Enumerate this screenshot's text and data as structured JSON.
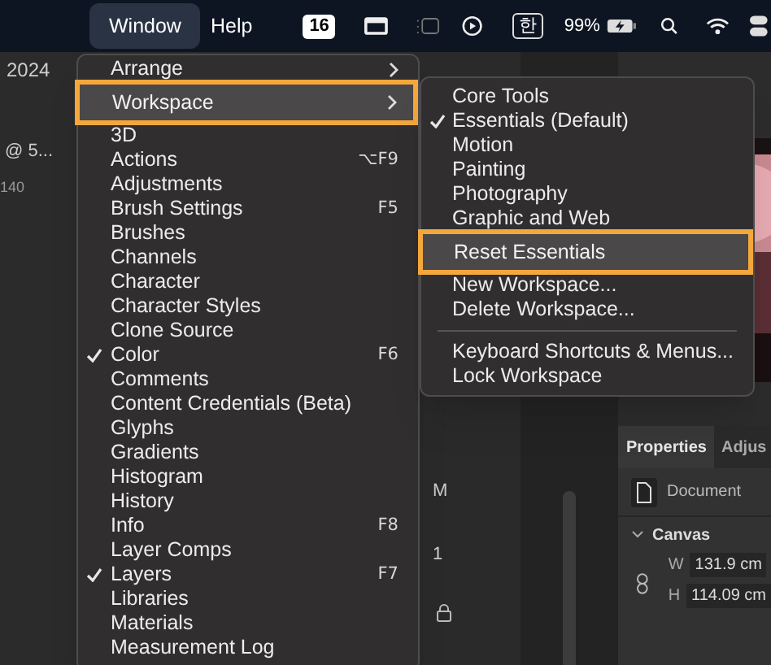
{
  "menu_bar": {
    "items": [
      {
        "label": "Window",
        "selected": true
      },
      {
        "label": "Help",
        "selected": false
      }
    ],
    "badge": "16",
    "input_source": "한",
    "battery": "99%"
  },
  "app": {
    "title_fragment": "2024",
    "doc_tab": "@ 5...",
    "ruler": "140",
    "layer_rows": [
      "M",
      "1"
    ],
    "properties": {
      "tabs": [
        {
          "label": "Properties",
          "selected": true
        },
        {
          "label": "Adjus",
          "selected": false
        }
      ],
      "document": "Document",
      "section": "Canvas",
      "fields": [
        {
          "label": "W",
          "value": "131.9 cm"
        },
        {
          "label": "H",
          "value": "114.09 cm"
        }
      ]
    }
  },
  "window_menu": {
    "items": [
      {
        "kind": "submenu",
        "label": "Arrange",
        "checked": false,
        "highlighted": false
      },
      {
        "kind": "submenu",
        "label": "Workspace",
        "checked": false,
        "highlighted": true
      },
      {
        "kind": "item",
        "label": "3D",
        "checked": false,
        "highlighted": false
      },
      {
        "kind": "item",
        "label": "Actions",
        "shortcut": "⌥F9",
        "checked": false,
        "highlighted": false
      },
      {
        "kind": "item",
        "label": "Adjustments",
        "checked": false,
        "highlighted": false
      },
      {
        "kind": "item",
        "label": "Brush Settings",
        "shortcut": "F5",
        "checked": false,
        "highlighted": false
      },
      {
        "kind": "item",
        "label": "Brushes",
        "checked": false,
        "highlighted": false
      },
      {
        "kind": "item",
        "label": "Channels",
        "checked": false,
        "highlighted": false
      },
      {
        "kind": "item",
        "label": "Character",
        "checked": false,
        "highlighted": false
      },
      {
        "kind": "item",
        "label": "Character Styles",
        "checked": false,
        "highlighted": false
      },
      {
        "kind": "item",
        "label": "Clone Source",
        "checked": false,
        "highlighted": false
      },
      {
        "kind": "item",
        "label": "Color",
        "shortcut": "F6",
        "checked": true,
        "highlighted": false
      },
      {
        "kind": "item",
        "label": "Comments",
        "checked": false,
        "highlighted": false
      },
      {
        "kind": "item",
        "label": "Content Credentials (Beta)",
        "checked": false,
        "highlighted": false
      },
      {
        "kind": "item",
        "label": "Glyphs",
        "checked": false,
        "highlighted": false
      },
      {
        "kind": "item",
        "label": "Gradients",
        "checked": false,
        "highlighted": false
      },
      {
        "kind": "item",
        "label": "Histogram",
        "checked": false,
        "highlighted": false
      },
      {
        "kind": "item",
        "label": "History",
        "checked": false,
        "highlighted": false
      },
      {
        "kind": "item",
        "label": "Info",
        "shortcut": "F8",
        "checked": false,
        "highlighted": false
      },
      {
        "kind": "item",
        "label": "Layer Comps",
        "checked": false,
        "highlighted": false
      },
      {
        "kind": "item",
        "label": "Layers",
        "shortcut": "F7",
        "checked": true,
        "highlighted": false
      },
      {
        "kind": "item",
        "label": "Libraries",
        "checked": false,
        "highlighted": false
      },
      {
        "kind": "item",
        "label": "Materials",
        "checked": false,
        "highlighted": false
      },
      {
        "kind": "item",
        "label": "Measurement Log",
        "checked": false,
        "highlighted": false
      }
    ]
  },
  "workspace_submenu": {
    "items": [
      {
        "kind": "item",
        "label": "Core Tools",
        "checked": false,
        "highlighted": false
      },
      {
        "kind": "item",
        "label": "Essentials (Default)",
        "checked": true,
        "highlighted": false
      },
      {
        "kind": "item",
        "label": "Motion",
        "checked": false,
        "highlighted": false
      },
      {
        "kind": "item",
        "label": "Painting",
        "checked": false,
        "highlighted": false
      },
      {
        "kind": "item",
        "label": "Photography",
        "checked": false,
        "highlighted": false
      },
      {
        "kind": "item",
        "label": "Graphic and Web",
        "checked": false,
        "highlighted": false
      },
      {
        "kind": "item",
        "label": "Reset Essentials",
        "checked": false,
        "highlighted": true
      },
      {
        "kind": "item",
        "label": "New Workspace...",
        "checked": false,
        "highlighted": false
      },
      {
        "kind": "item",
        "label": "Delete Workspace...",
        "checked": false,
        "highlighted": false
      },
      {
        "kind": "separator"
      },
      {
        "kind": "item",
        "label": "Keyboard Shortcuts & Menus...",
        "checked": false,
        "highlighted": false
      },
      {
        "kind": "item",
        "label": "Lock Workspace",
        "checked": false,
        "highlighted": false
      }
    ]
  }
}
